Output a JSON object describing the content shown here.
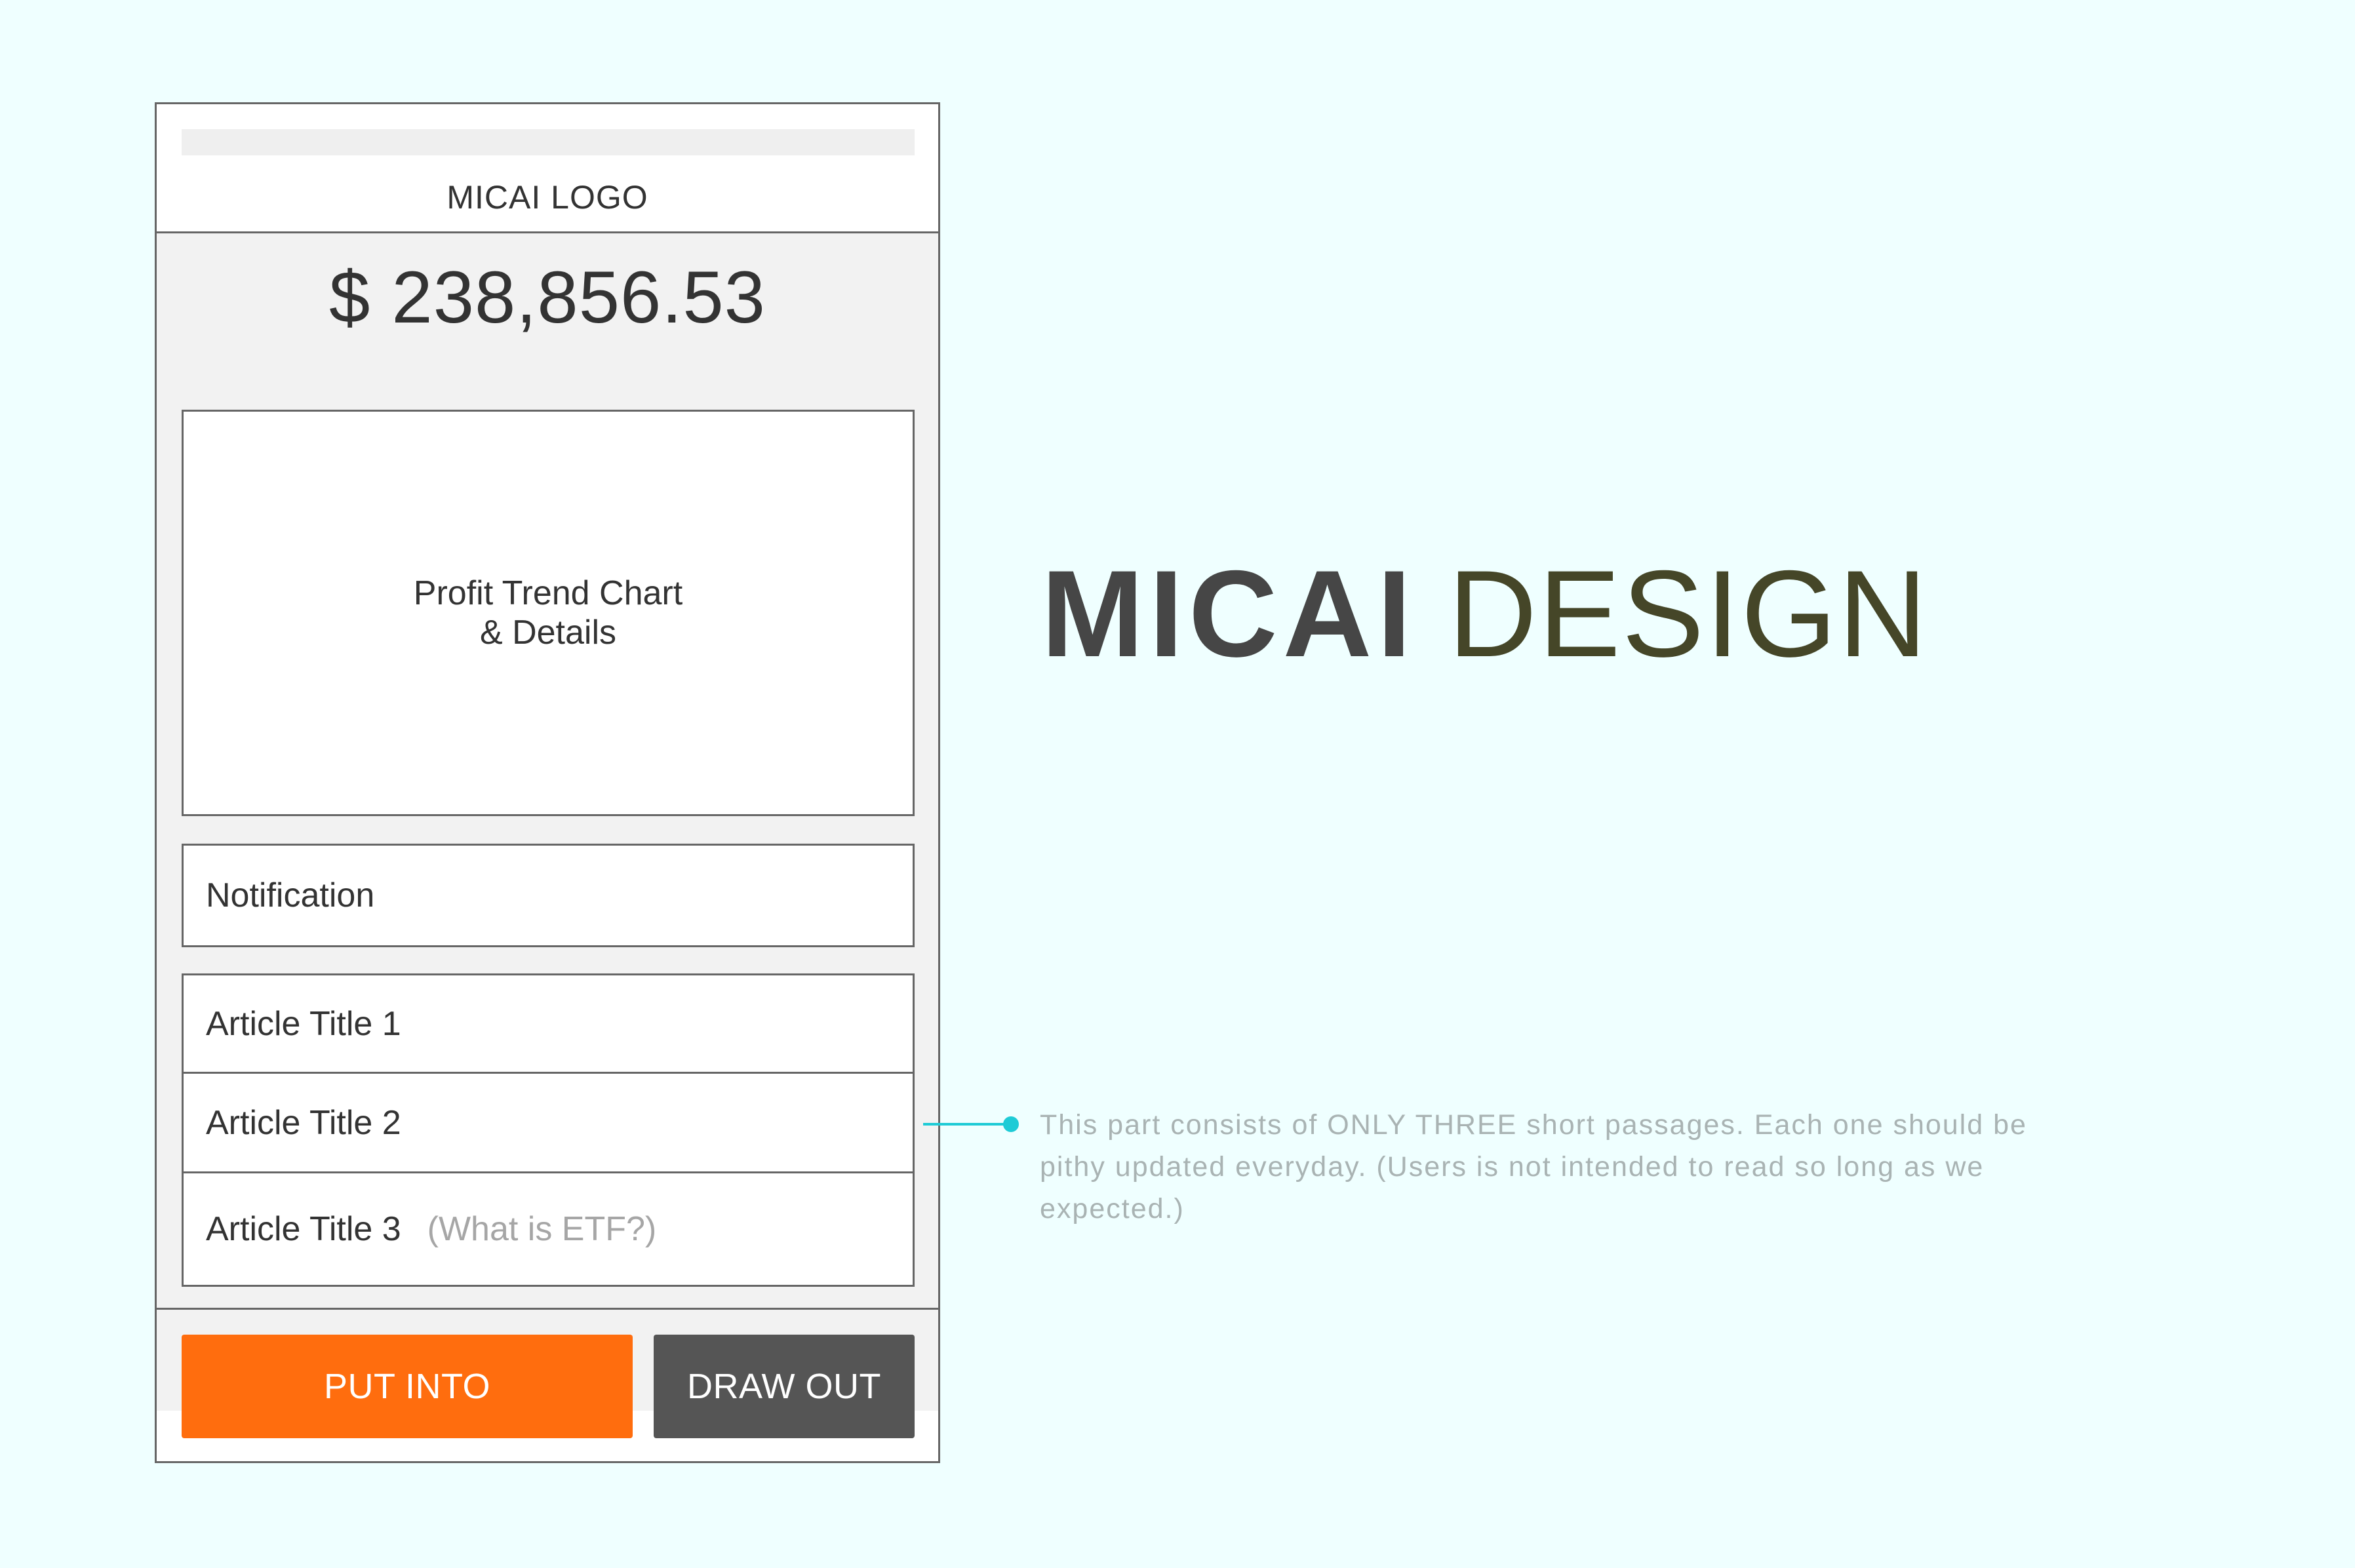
{
  "app": {
    "logo_text": "MICAI LOGO",
    "balance": "$ 238,856.53",
    "chart_placeholder": "Profit Trend Chart\n& Details",
    "notification": "Notification",
    "articles": [
      {
        "title": "Article Title 1",
        "note": ""
      },
      {
        "title": "Article Title 2",
        "note": ""
      },
      {
        "title": "Article Title 3",
        "note": "(What is ETF?)"
      }
    ],
    "buttons": {
      "put_into": "PUT INTO",
      "draw_out": "DRAW OUT"
    }
  },
  "annotation": {
    "text": "This part consists of ONLY THREE short passages. Each one should be pithy updated everyday. (Users is not intended to read so long as we expected.)"
  },
  "brand": {
    "bold": "MICAI",
    "light": "DESIGN"
  },
  "colors": {
    "background": "#efffff",
    "accent_orange": "#ff6d0e",
    "button_dark": "#555555",
    "connector": "#1ecbd6"
  }
}
